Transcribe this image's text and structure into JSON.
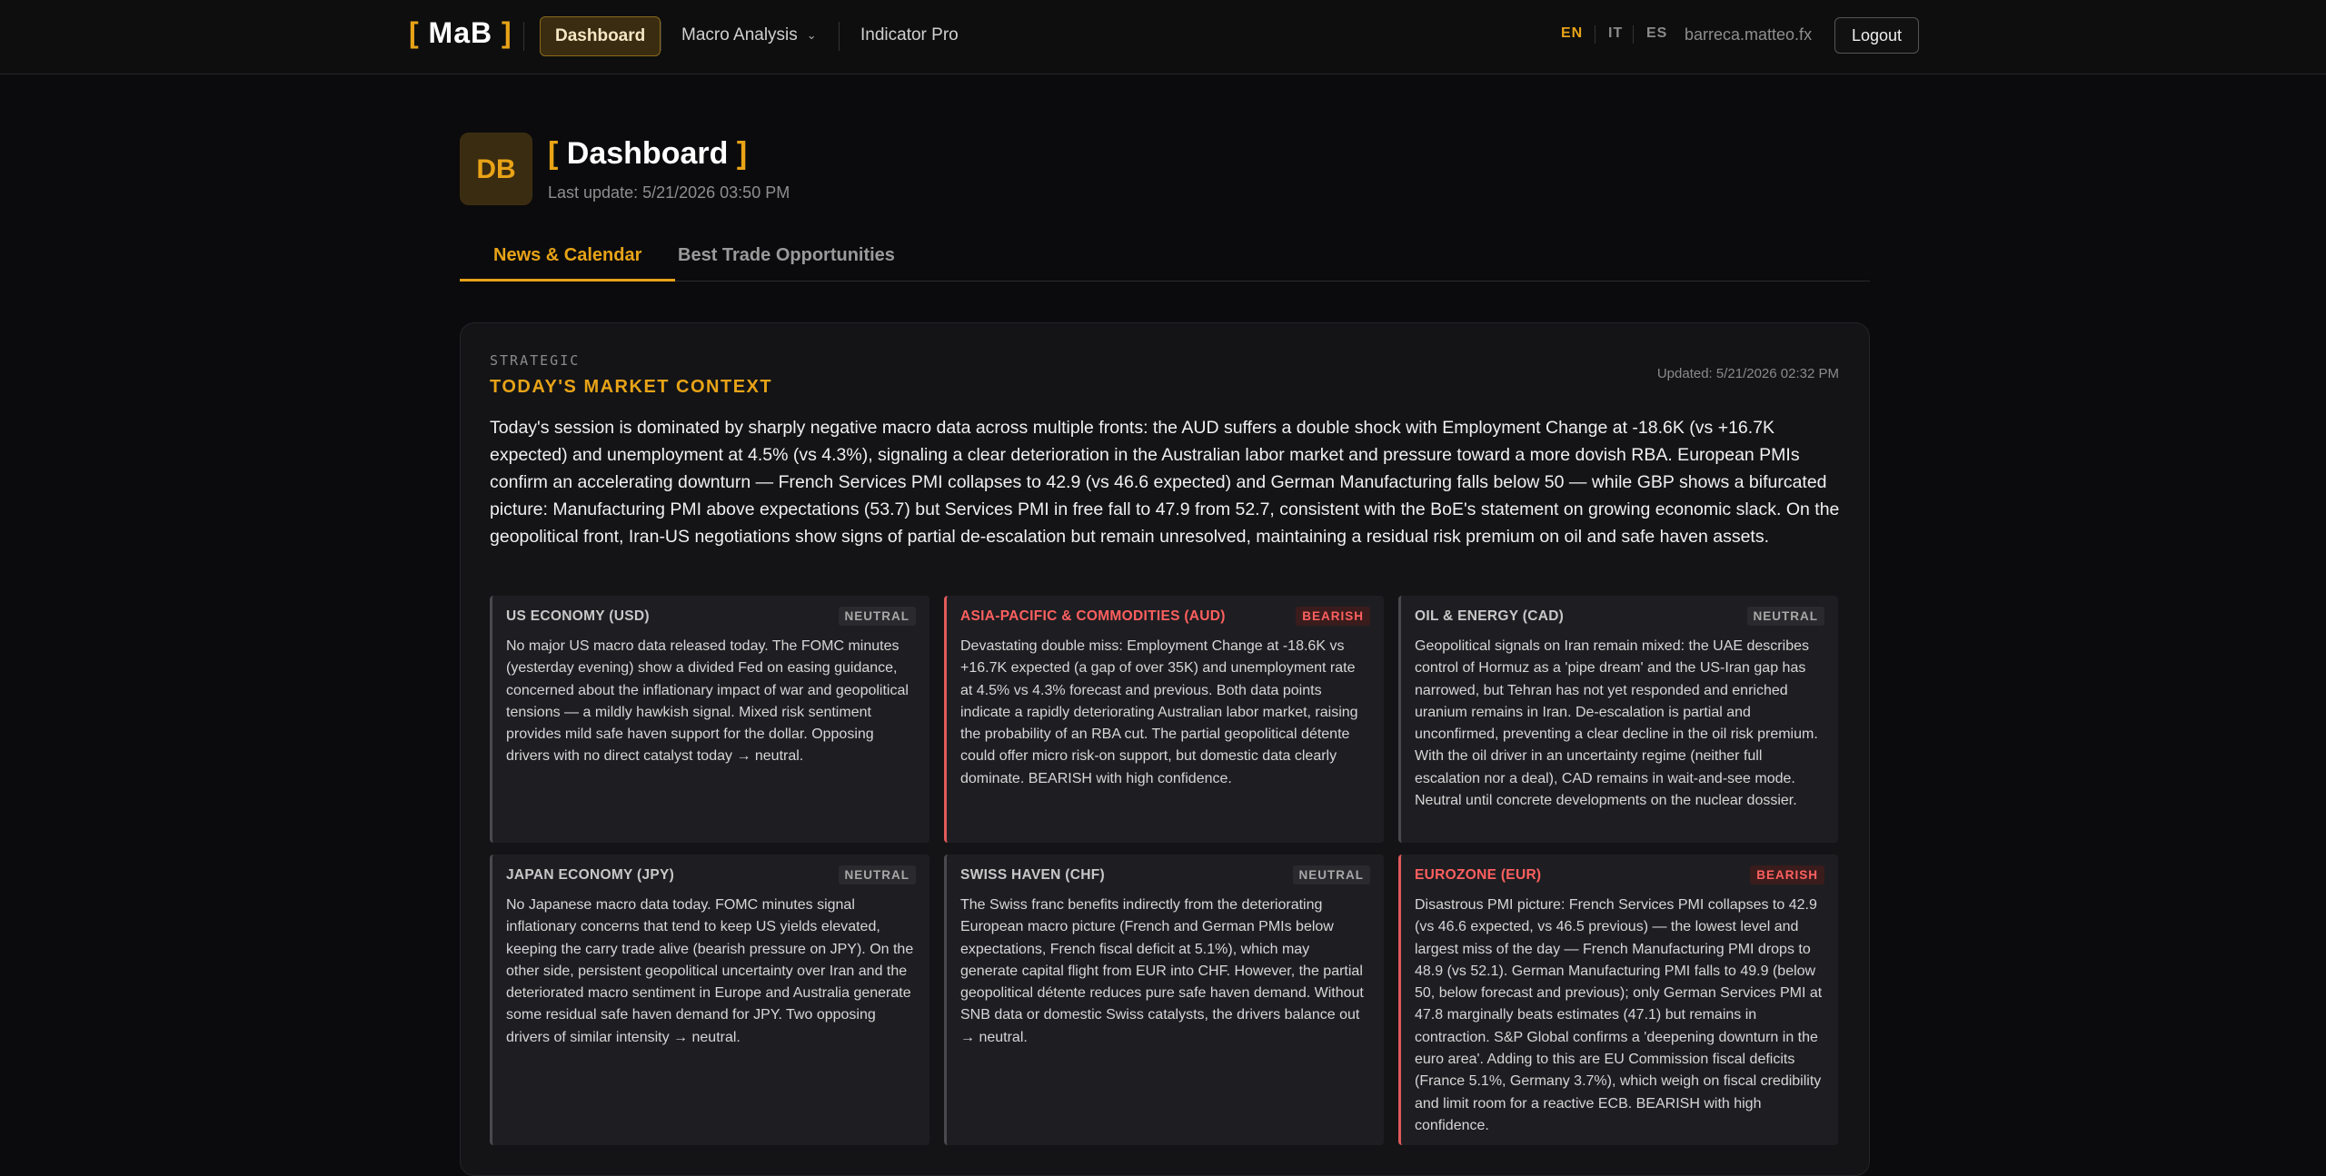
{
  "nav": {
    "brand_open": "[",
    "brand_name": "MaB",
    "brand_close": "]",
    "dashboard": "Dashboard",
    "macro": "Macro Analysis",
    "indicator": "Indicator Pro",
    "langs": [
      "EN",
      "IT",
      "ES"
    ],
    "active_lang": "EN",
    "user": "barreca.matteo.fx",
    "logout": "Logout"
  },
  "header": {
    "avatar": "DB",
    "title_open": "[",
    "title": "Dashboard",
    "title_close": "]",
    "last_update": "Last update: 5/21/2026 03:50 PM"
  },
  "tabs": [
    {
      "label": "News & Calendar",
      "active": true
    },
    {
      "label": "Best Trade Opportunities",
      "active": false
    }
  ],
  "context": {
    "eyebrow": "STRATEGIC",
    "title": "TODAY'S MARKET CONTEXT",
    "updated": "Updated: 5/21/2026 02:32 PM",
    "summary": "Today's session is dominated by sharply negative macro data across multiple fronts: the AUD suffers a double shock with Employment Change at -18.6K (vs +16.7K expected) and unemployment at 4.5% (vs 4.3%), signaling a clear deterioration in the Australian labor market and pressure toward a more dovish RBA. European PMIs confirm an accelerating downturn — French Services PMI collapses to 42.9 (vs 46.6 expected) and German Manufacturing falls below 50 — while GBP shows a bifurcated picture: Manufacturing PMI above expectations (53.7) but Services PMI in free fall to 47.9 from 52.7, consistent with the BoE's statement on growing economic slack. On the geopolitical front, Iran-US negotiations show signs of partial de-escalation but remain unresolved, maintaining a residual risk premium on oil and safe haven assets.",
    "cards": [
      {
        "title": "US ECONOMY (USD)",
        "badge": "NEUTRAL",
        "bias": "neutral",
        "body": "No major US macro data released today. The FOMC minutes (yesterday evening) show a divided Fed on easing guidance, concerned about the inflationary impact of war and geopolitical tensions — a mildly hawkish signal. Mixed risk sentiment provides mild safe haven support for the dollar. Opposing drivers with no direct catalyst today → neutral."
      },
      {
        "title": "ASIA-PACIFIC & COMMODITIES (AUD)",
        "badge": "BEARISH",
        "bias": "bearish",
        "body": "Devastating double miss: Employment Change at -18.6K vs +16.7K expected (a gap of over 35K) and unemployment rate at 4.5% vs 4.3% forecast and previous. Both data points indicate a rapidly deteriorating Australian labor market, raising the probability of an RBA cut. The partial geopolitical détente could offer micro risk-on support, but domestic data clearly dominate. BEARISH with high confidence."
      },
      {
        "title": "OIL & ENERGY (CAD)",
        "badge": "NEUTRAL",
        "bias": "neutral",
        "body": "Geopolitical signals on Iran remain mixed: the UAE describes control of Hormuz as a 'pipe dream' and the US-Iran gap has narrowed, but Tehran has not yet responded and enriched uranium remains in Iran. De-escalation is partial and unconfirmed, preventing a clear decline in the oil risk premium. With the oil driver in an uncertainty regime (neither full escalation nor a deal), CAD remains in wait-and-see mode. Neutral until concrete developments on the nuclear dossier."
      },
      {
        "title": "JAPAN ECONOMY (JPY)",
        "badge": "NEUTRAL",
        "bias": "neutral",
        "body": "No Japanese macro data today. FOMC minutes signal inflationary concerns that tend to keep US yields elevated, keeping the carry trade alive (bearish pressure on JPY). On the other side, persistent geopolitical uncertainty over Iran and the deteriorated macro sentiment in Europe and Australia generate some residual safe haven demand for JPY. Two opposing drivers of similar intensity → neutral."
      },
      {
        "title": "SWISS HAVEN (CHF)",
        "badge": "NEUTRAL",
        "bias": "neutral",
        "body": "The Swiss franc benefits indirectly from the deteriorating European macro picture (French and German PMIs below expectations, French fiscal deficit at 5.1%), which may generate capital flight from EUR into CHF. However, the partial geopolitical détente reduces pure safe haven demand. Without SNB data or domestic Swiss catalysts, the drivers balance out → neutral."
      },
      {
        "title": "EUROZONE (EUR)",
        "badge": "BEARISH",
        "bias": "bearish",
        "body": "Disastrous PMI picture: French Services PMI collapses to 42.9 (vs 46.6 expected, vs 46.5 previous) — the lowest level and largest miss of the day — French Manufacturing PMI drops to 48.9 (vs 52.1). German Manufacturing PMI falls to 49.9 (below 50, below forecast and previous); only German Services PMI at 47.8 marginally beats estimates (47.1) but remains in contraction. S&P Global confirms a 'deepening downturn in the euro area'. Adding to this are EU Commission fiscal deficits (France 5.1%, Germany 3.7%), which weigh on fiscal credibility and limit room for a reactive ECB. BEARISH with high confidence."
      }
    ]
  }
}
